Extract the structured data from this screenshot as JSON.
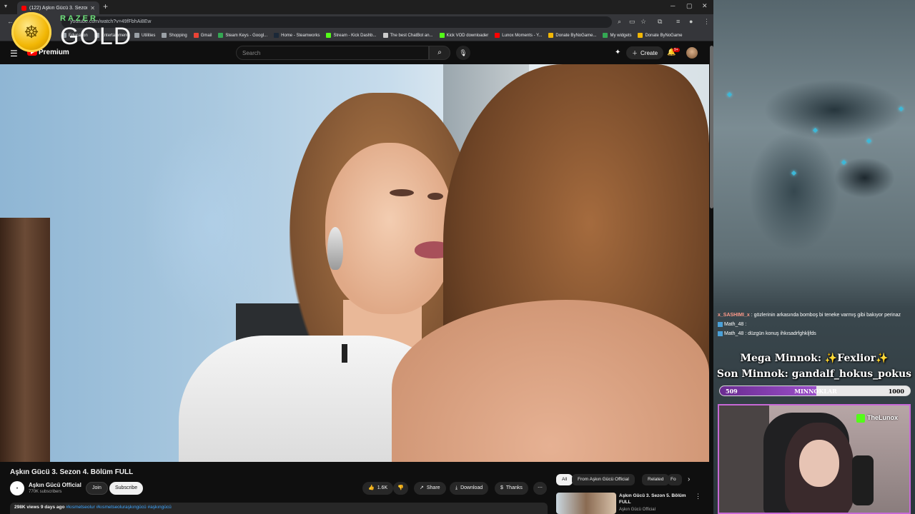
{
  "browser": {
    "tab_title": "(122) Aşkın Gücü 3. Sezon",
    "url": "youtube.com/watch?v=49fFbhAi8Ew",
    "bookmarks": [
      {
        "label": "Education",
        "color": "#9aa0a6"
      },
      {
        "label": "Entertainment",
        "color": "#9aa0a6"
      },
      {
        "label": "Utilities",
        "color": "#9aa0a6"
      },
      {
        "label": "Shopping",
        "color": "#9aa0a6"
      },
      {
        "label": "Gmail",
        "color": "#ea4335"
      },
      {
        "label": "Steam Keys - Googl...",
        "color": "#34a853"
      },
      {
        "label": "Home - Steamworks",
        "color": "#1b2838"
      },
      {
        "label": "Stream - Kick Dashb...",
        "color": "#53fc18"
      },
      {
        "label": "The best ChatBot an...",
        "color": "#cccccc"
      },
      {
        "label": "Kick VOD downloader",
        "color": "#53fc18"
      },
      {
        "label": "Lunox Moments - Y...",
        "color": "#ff0000"
      },
      {
        "label": "Donate ByNoGame...",
        "color": "#f2b705"
      },
      {
        "label": "My widgets",
        "color": "#34a853"
      },
      {
        "label": "Donate ByNoGame",
        "color": "#f2b705"
      }
    ]
  },
  "razer": {
    "brand": "RAZER",
    "tier": "GOLD"
  },
  "youtube": {
    "logo_text": "Premium",
    "search_placeholder": "Search",
    "create_label": "Create",
    "notif_count": "9+",
    "video": {
      "title": "Aşkın Gücü 3. Sezon 4. Bölüm FULL",
      "channel": "Aşkın Gücü Official",
      "subscribers": "770K subscribers",
      "join_label": "Join",
      "subscribe_label": "Subscribe",
      "likes": "1.6K",
      "share_label": "Share",
      "download_label": "Download",
      "thanks_label": "Thanks",
      "views": "298K views",
      "age": "9 days ago",
      "tags": "#kısmetseolur #kısmetseoluraşkıngücü #aşkıngücü"
    },
    "chips": [
      {
        "label": "All",
        "active": true
      },
      {
        "label": "From Aşkın Gücü Official",
        "active": false
      },
      {
        "label": "Related",
        "active": false
      },
      {
        "label": "Fo",
        "active": false
      }
    ],
    "recommendation": {
      "title": "Aşkın Gücü 3. Sezon 5. Bölüm FULL",
      "channel": "Aşkın Gücü Official"
    }
  },
  "stream": {
    "chat": [
      {
        "user": "x_SASHIMI_x",
        "text": " : gözlerinin arkasında bomboş bi teneke varmış gibi bakıyor perinaz",
        "highlight": true
      },
      {
        "user": "Math_48",
        "text": " : ",
        "highlight": false
      },
      {
        "user": "Math_48",
        "text": " : düzgün konuş ihkısadrfghkljfds",
        "highlight": false
      }
    ],
    "mega_minnok": "Mega Minnok: ✨Fexlior✨",
    "son_minnok": "Son Minnok: gandalf_hokus_pokus",
    "progress": {
      "current": "509",
      "label": "MINNOKLAR",
      "goal": "1000",
      "fraction": 0.509
    },
    "cam_name": "TheLunox"
  }
}
